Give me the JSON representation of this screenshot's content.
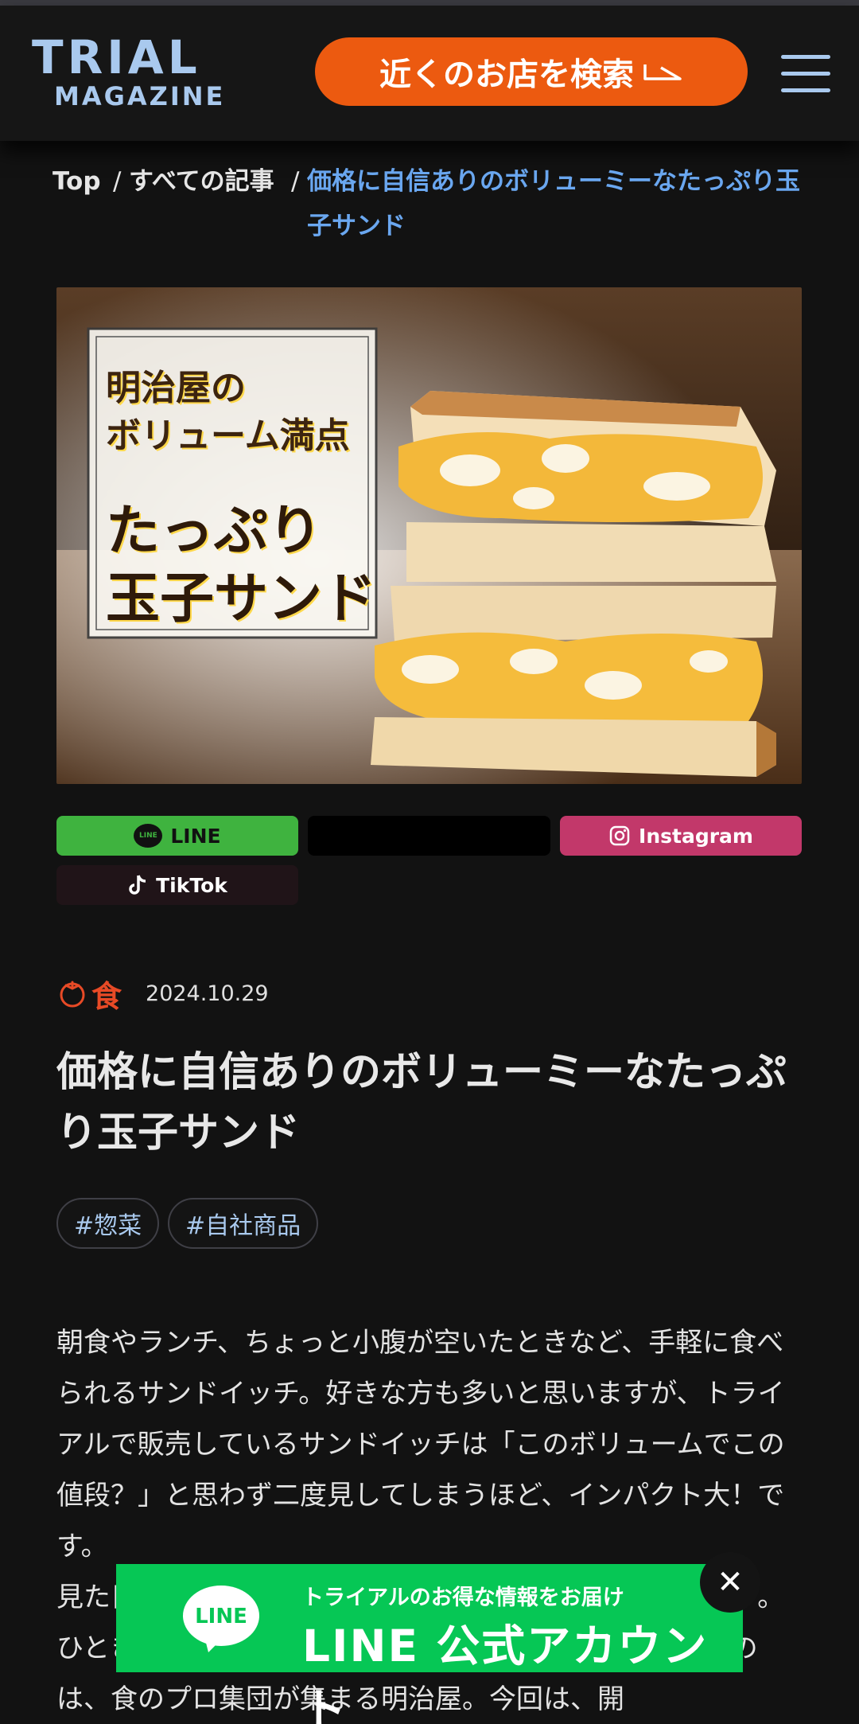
{
  "header": {
    "logo_top": "TRIAL",
    "logo_bottom": "MAGAZINE",
    "search_label": "近くのお店を検索",
    "menu_icon": "hamburger-icon"
  },
  "breadcrumb": {
    "top": "Top",
    "separator": "/",
    "all": "すべての記事",
    "current": "価格に自信ありのボリューミーなたっぷり玉子サンド"
  },
  "hero": {
    "line1": "明治屋の",
    "line2": "ボリューム満点",
    "line3": "たっぷり",
    "line4": "玉子サンド"
  },
  "share": {
    "line": "LINE",
    "x": "",
    "instagram": "Instagram",
    "tiktok": "TikTok",
    "line_mark": "LINE"
  },
  "article": {
    "category": "食",
    "category_icon": "tomato-icon",
    "date": "2024.10.29",
    "title": "価格に自信ありのボリューミーなたっぷり玉子サンド",
    "tags": [
      "#惣菜",
      "#自社商品"
    ],
    "body": "朝食やランチ、ちょっと小腹が空いたときなど、手軽に食べられるサンドイッチ。好きな方も多いと思いますが、トライアルで販売しているサンドイッチは「このボリュームでこの値段？」と思わず二度見してしまうほど、インパクト大！です。\n見た目も味もこだわった、ボリューム満点のサンドイッチ。ひときわ存在感を放つ、たっぷり玉子サンドを開発したのは、食のプロ集団が集まる明治屋。今回は、開"
  },
  "line_banner": {
    "logo_text": "LINE",
    "sub": "トライアルのお得な情報をお届け",
    "main": "LINE 公式アカウント",
    "close": "✕"
  },
  "colors": {
    "accent_orange": "#ec5a10",
    "link_blue": "#6aa7f0",
    "logo_blue": "#a9c9ee",
    "line_green": "#06c755",
    "category_red": "#e84a26"
  }
}
